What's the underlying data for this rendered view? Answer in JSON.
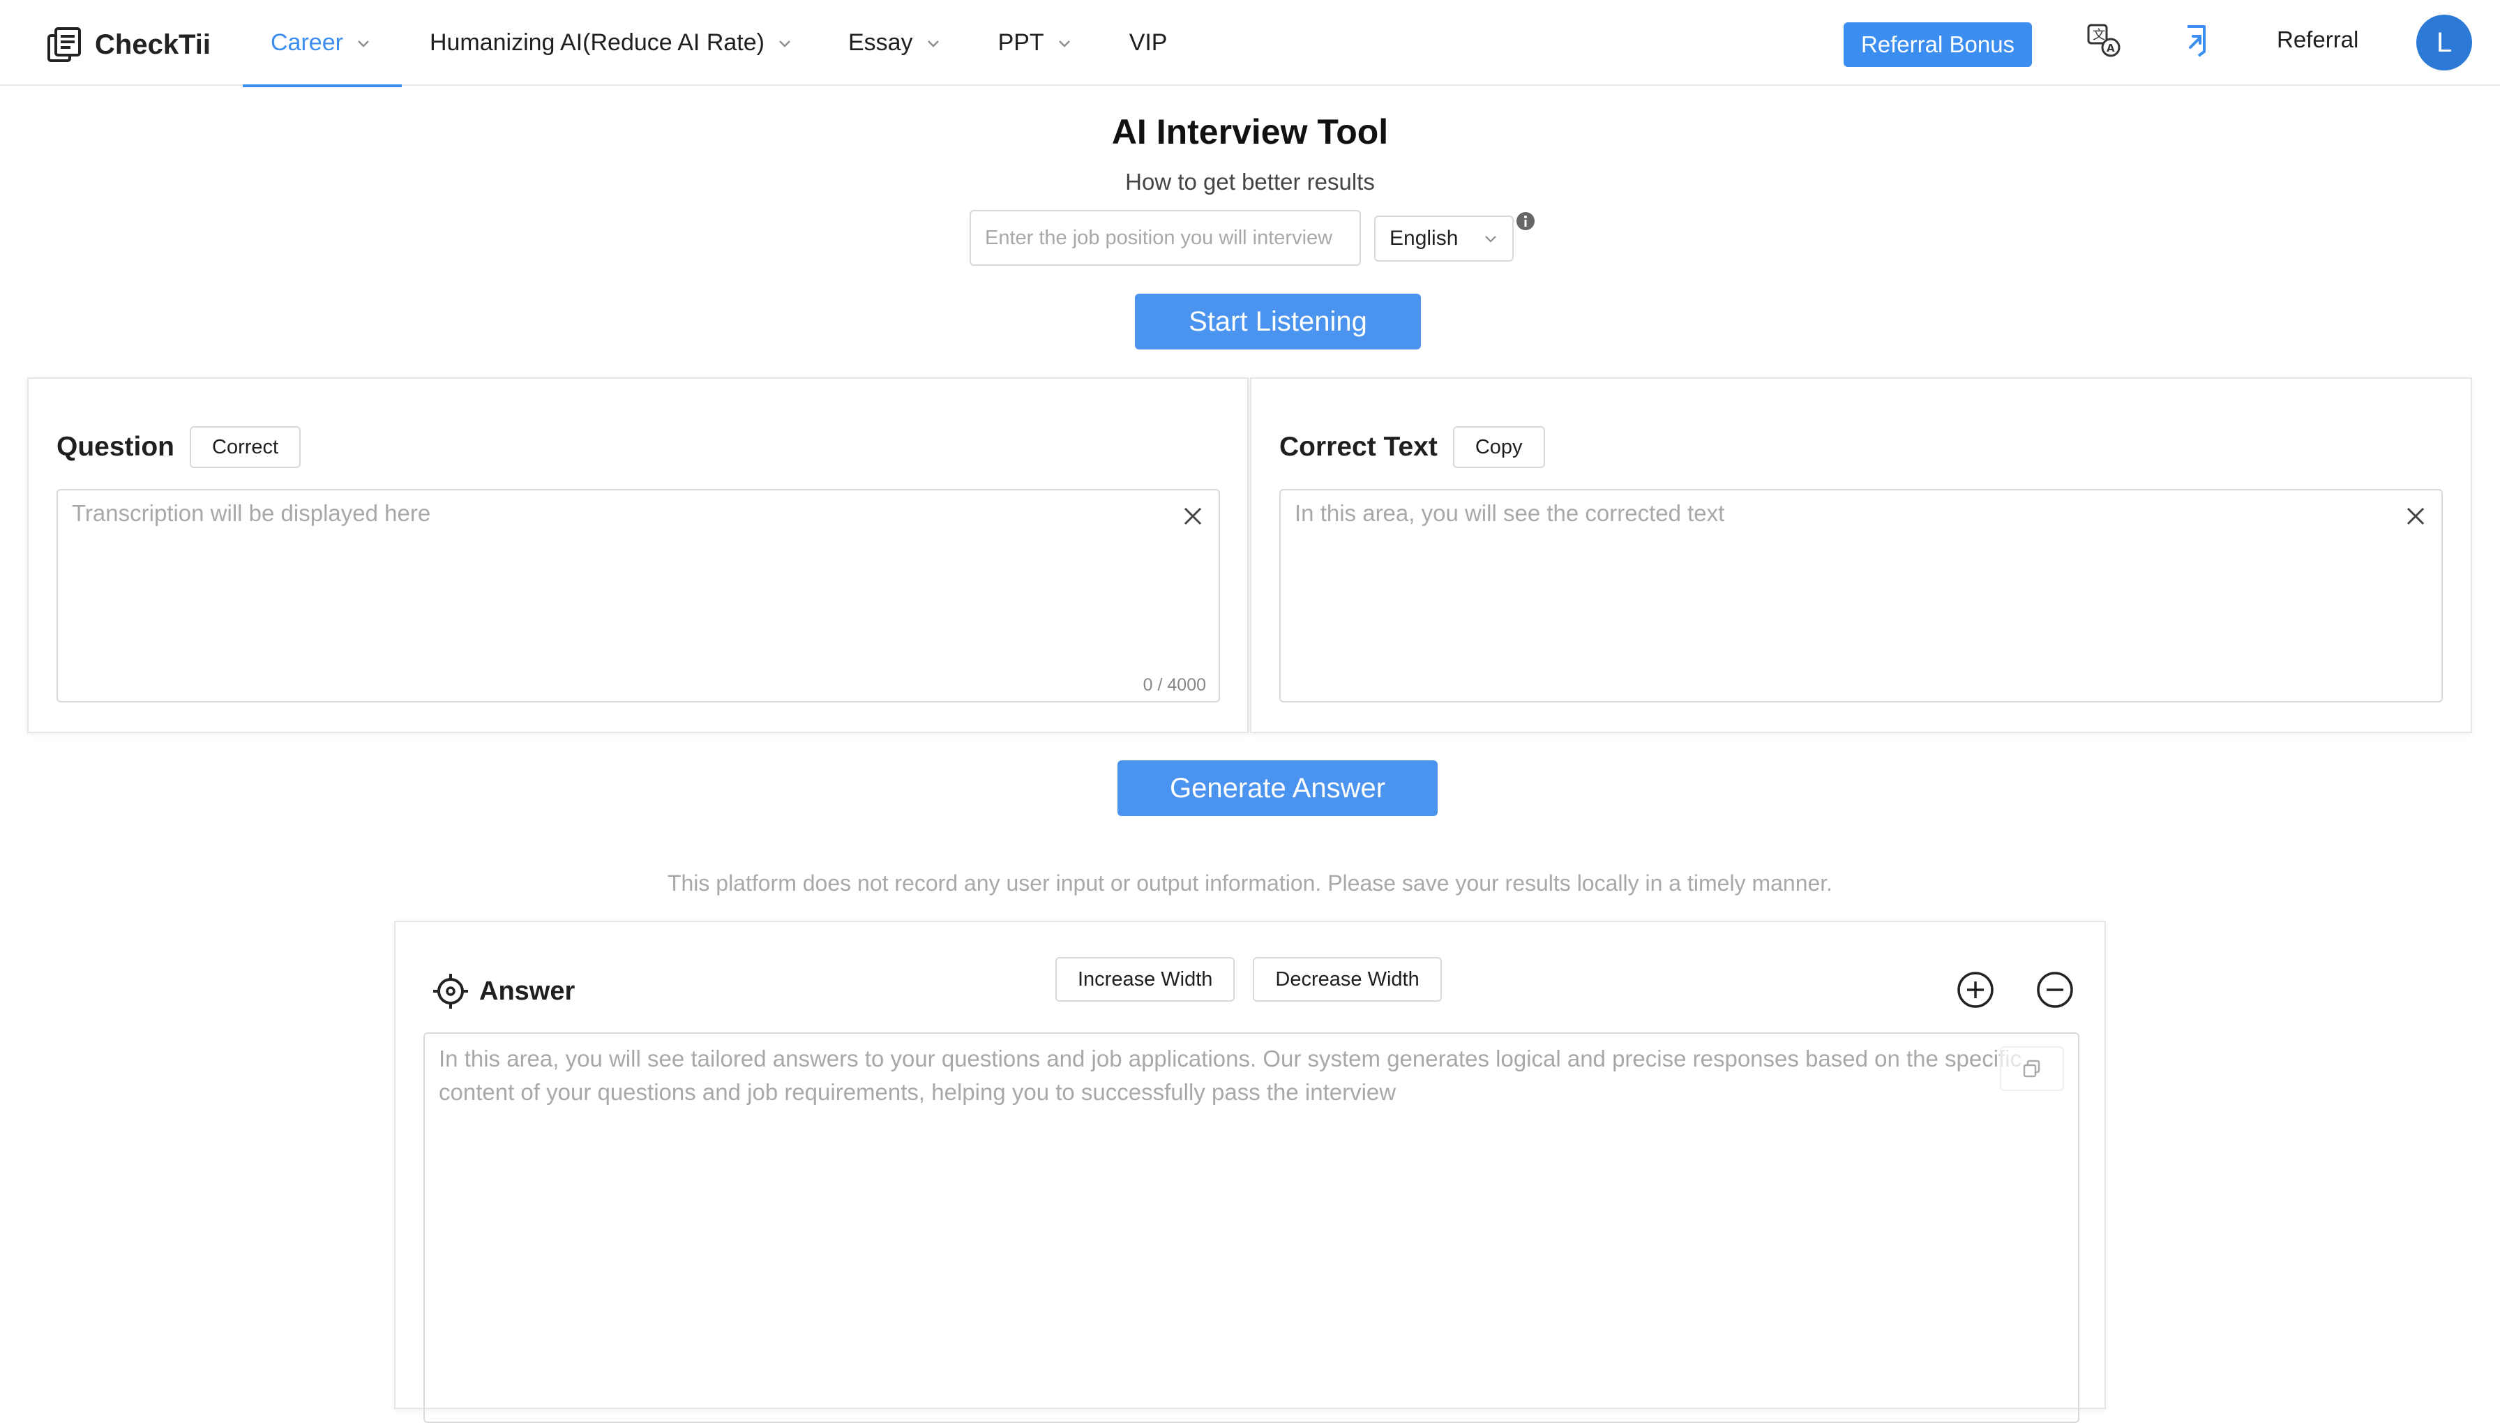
{
  "header": {
    "logo_text": "CheckTii",
    "nav": [
      {
        "label": "Career",
        "has_dropdown": true,
        "active": true
      },
      {
        "label": "Humanizing AI(Reduce AI Rate)",
        "has_dropdown": true,
        "active": false
      },
      {
        "label": "Essay",
        "has_dropdown": true,
        "active": false
      },
      {
        "label": "PPT",
        "has_dropdown": true,
        "active": false
      },
      {
        "label": "VIP",
        "has_dropdown": false,
        "active": false
      }
    ],
    "referral_bonus_label": "Referral Bonus",
    "referral_label": "Referral",
    "avatar_initial": "L",
    "icons": [
      "translate-icon",
      "share-arrow-icon"
    ],
    "accent_color": "#3b8ef0"
  },
  "main": {
    "title": "AI Interview Tool",
    "subtitle": "How to get better results",
    "job_input_placeholder": "Enter the job position you will interview",
    "language_selected": "English",
    "start_button": "Start Listening"
  },
  "question_panel": {
    "title": "Question",
    "action_button": "Correct",
    "placeholder": "Transcription will be displayed here",
    "counter": "0 / 4000"
  },
  "correct_panel": {
    "title": "Correct Text",
    "action_button": "Copy",
    "placeholder": "In this area, you will see the corrected text"
  },
  "generate_button": "Generate Answer",
  "notice": "This platform does not record any user input or output information. Please save your results locally in a timely manner.",
  "answer_panel": {
    "title": "Answer",
    "increase_width": "Increase Width",
    "decrease_width": "Decrease Width",
    "placeholder": "In this area, you will see tailored answers to your questions and job applications. Our system generates logical and precise responses based on the specific content of your questions and job requirements, helping you to successfully pass the interview"
  }
}
